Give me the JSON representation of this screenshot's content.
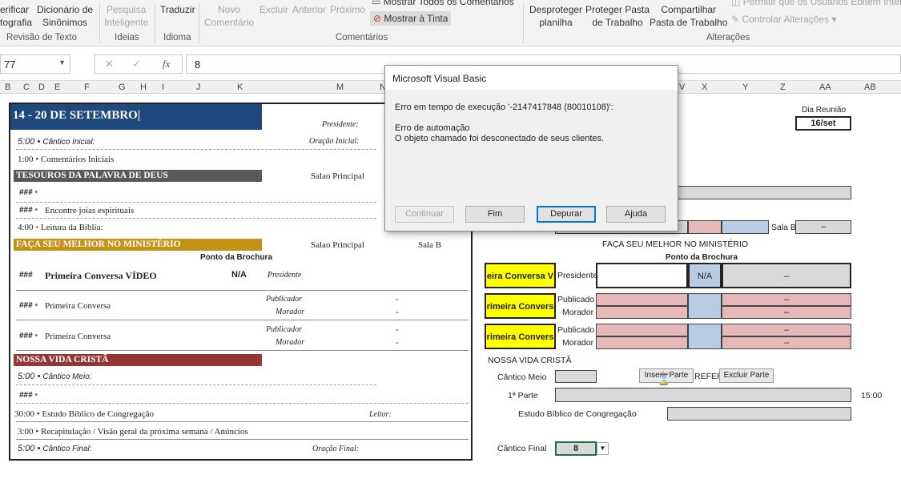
{
  "ribbon": {
    "verificar": [
      "erificar",
      "tografia"
    ],
    "dicionario": [
      "Dicionário de",
      "Sinônimos"
    ],
    "pesquisa": [
      "Pesquisa",
      "Inteligente"
    ],
    "traduzir": "Traduzir",
    "novo_comentario": [
      "Novo",
      "Comentário"
    ],
    "excluir": "Excluir",
    "anterior": "Anterior",
    "proximo": "Próximo",
    "mostrar_todos": "Mostrar Todos os Comentários",
    "mostrar_tinta": "Mostrar à Tinta",
    "desproteger": [
      "Desproteger",
      "planilha"
    ],
    "proteger_pasta": [
      "Proteger Pasta",
      "de Trabalho"
    ],
    "compartilhar": [
      "Compartilhar",
      "Pasta de Trabalho"
    ],
    "permitir": "Permitir que os Usuários Editem Inter",
    "controlar": "Controlar Alterações",
    "groups": {
      "revisao": "Revisão de Texto",
      "ideias": "Ideias",
      "idioma": "Idioma",
      "comentarios": "Comentários",
      "alteracoes": "Alterações"
    }
  },
  "formula_bar": {
    "name_box": "77",
    "cancel": "✕",
    "enter": "✓",
    "fx": "fx",
    "value": "8"
  },
  "columns": [
    "B",
    "C",
    "D",
    "E",
    "F",
    "G",
    "H",
    "I",
    "J",
    "K",
    "M",
    "N",
    "V",
    "X",
    "Y",
    "Z",
    "AA",
    "AB"
  ],
  "sheet": {
    "week": "14 - 20 DE SETEMBRO|",
    "presidente": "Presidente:",
    "oracao_inicial": "Oração Inicial:",
    "r1_time": "5:00",
    "r1_text": "Cântico Inicial:",
    "r2_time": "1:00",
    "r2_text": "Comentários Iniciais",
    "tesouros": "TESOUROS DA PALAVRA DE DEUS",
    "salao_principal": "Salao Principal",
    "r3_time": "###",
    "r4_time": "###",
    "r4_text": "Encontre joias espirituais",
    "r5_time": "4:00",
    "r5_text": "Leitura da Bíblia:",
    "faca": "FAÇA SEU MELHOR NO MINISTÉRIO",
    "salao_principal2": "Salao Principal",
    "sala_b": "Sala B",
    "ponto": "Ponto da Brochura",
    "r6_time": "###",
    "r6_text": "Primeira Conversa VÍDEO",
    "r6_na": "N/A",
    "r6_pres": "Presidente",
    "r7_time": "###",
    "r7_text": "Primeira Conversa",
    "publicador": "Publicador",
    "morador": "Morador",
    "dash": "-",
    "r8_time": "###",
    "r8_text": "Primeira Conversa",
    "nossa": "NOSSA VIDA CRISTÃ",
    "r9_time": "5:00",
    "r9_text": "Cântico Meio:",
    "r10_time": "###",
    "r11_time": "30:00",
    "r11_text": "Estudo Bíblico de Congregação",
    "leitor": "Leitor:",
    "r12_time": "3:00",
    "r12_text": "Recapitulação / Visão geral da próxima semana / Anúncios",
    "r13_time": "5:00",
    "r13_text": "Cântico Final:",
    "oracao_final": "Oração Final:"
  },
  "right": {
    "dia_reuniao": "Dia Reunião",
    "dia_value": "16/set",
    "sala_b": "Sala B",
    "dash": "–",
    "faca": "FAÇA SEU MELHOR NO MINISTÉRIO",
    "ponto": "Ponto da Brochura",
    "pc_video": "eira Conversa V",
    "presidente": "Presidente",
    "na": "N/A",
    "pc1": "rimeira Convers",
    "pc2": "rimeira Convers",
    "publicado": "Publicado",
    "morador": "Morador",
    "nossa": "NOSSA VIDA CRISTÃ",
    "cantico_meio": "Cântico Meio",
    "inserir_parte": "Inserir Parte",
    "refer": "REFERÊ",
    "excluir_parte": "Excluir Parte",
    "primeira_parte": "1ª Parte",
    "time_1500": "15:00",
    "estudo": "Estudo Bíblico de Congregação",
    "cantico_final": "Cântico Final",
    "cantico_final_value": "8"
  },
  "dialog": {
    "title": "Microsoft Visual Basic",
    "line1": "Erro em tempo de execução '-2147417848 (80010108)':",
    "line2": "Erro de automação",
    "line3": "O objeto chamado foi desconectado de seus clientes.",
    "btn_continuar": "Continuar",
    "btn_fim": "Fim",
    "btn_depurar": "Depurar",
    "btn_ajuda": "Ajuda"
  },
  "colors": {
    "blue_header": "#1f497d",
    "gray_header": "#595959",
    "gold_header": "#c69214",
    "red_header": "#963634",
    "yellow": "#ffff00"
  }
}
